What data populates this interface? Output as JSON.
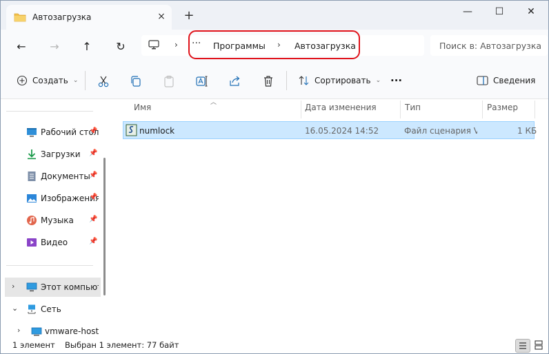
{
  "tab": {
    "title": "Автозагрузка",
    "close_icon": "×",
    "new_tab": "+"
  },
  "window_controls": {
    "minimize": "—",
    "maximize": "☐",
    "close": "✕"
  },
  "nav": {
    "back": "←",
    "forward": "→",
    "up": "↑",
    "refresh": "↻"
  },
  "address": {
    "more": "···",
    "separator": "›",
    "crumbs": [
      "Программы",
      "Автозагрузка"
    ]
  },
  "search": {
    "placeholder": "Поиск в: Автозагрузка"
  },
  "toolbar": {
    "create": "Создать",
    "sort": "Сортировать",
    "more": "···",
    "details": "Сведения"
  },
  "sidebar": {
    "items": [
      {
        "label": "Рабочий стол",
        "icon": "desktop-icon",
        "pinned": true
      },
      {
        "label": "Загрузки",
        "icon": "download-icon",
        "pinned": true
      },
      {
        "label": "Документы",
        "icon": "documents-icon",
        "pinned": true
      },
      {
        "label": "Изображения",
        "icon": "pictures-icon",
        "pinned": true
      },
      {
        "label": "Музыка",
        "icon": "music-icon",
        "pinned": true
      },
      {
        "label": "Видео",
        "icon": "video-icon",
        "pinned": true
      }
    ],
    "tree": [
      {
        "label": "Этот компьютер",
        "icon": "computer-icon",
        "expander": "›"
      },
      {
        "label": "Сеть",
        "icon": "network-icon",
        "expander": "⌄"
      },
      {
        "label": "vmware-host",
        "icon": "network-drive-icon",
        "expander": "›"
      }
    ],
    "pin_glyph": "📌"
  },
  "columns": [
    "Имя",
    "Дата изменения",
    "Тип",
    "Размер"
  ],
  "files": [
    {
      "name": "numlock",
      "modified": "16.05.2024 14:52",
      "type": "Файл сценария V...",
      "size": "1 КБ"
    }
  ],
  "status": {
    "count": "1 элемент",
    "selection": "Выбран 1 элемент: 77 байт"
  },
  "colors": {
    "selection": "#cce8ff",
    "selection_border": "#99d1ff",
    "highlight": "#e0121a"
  }
}
